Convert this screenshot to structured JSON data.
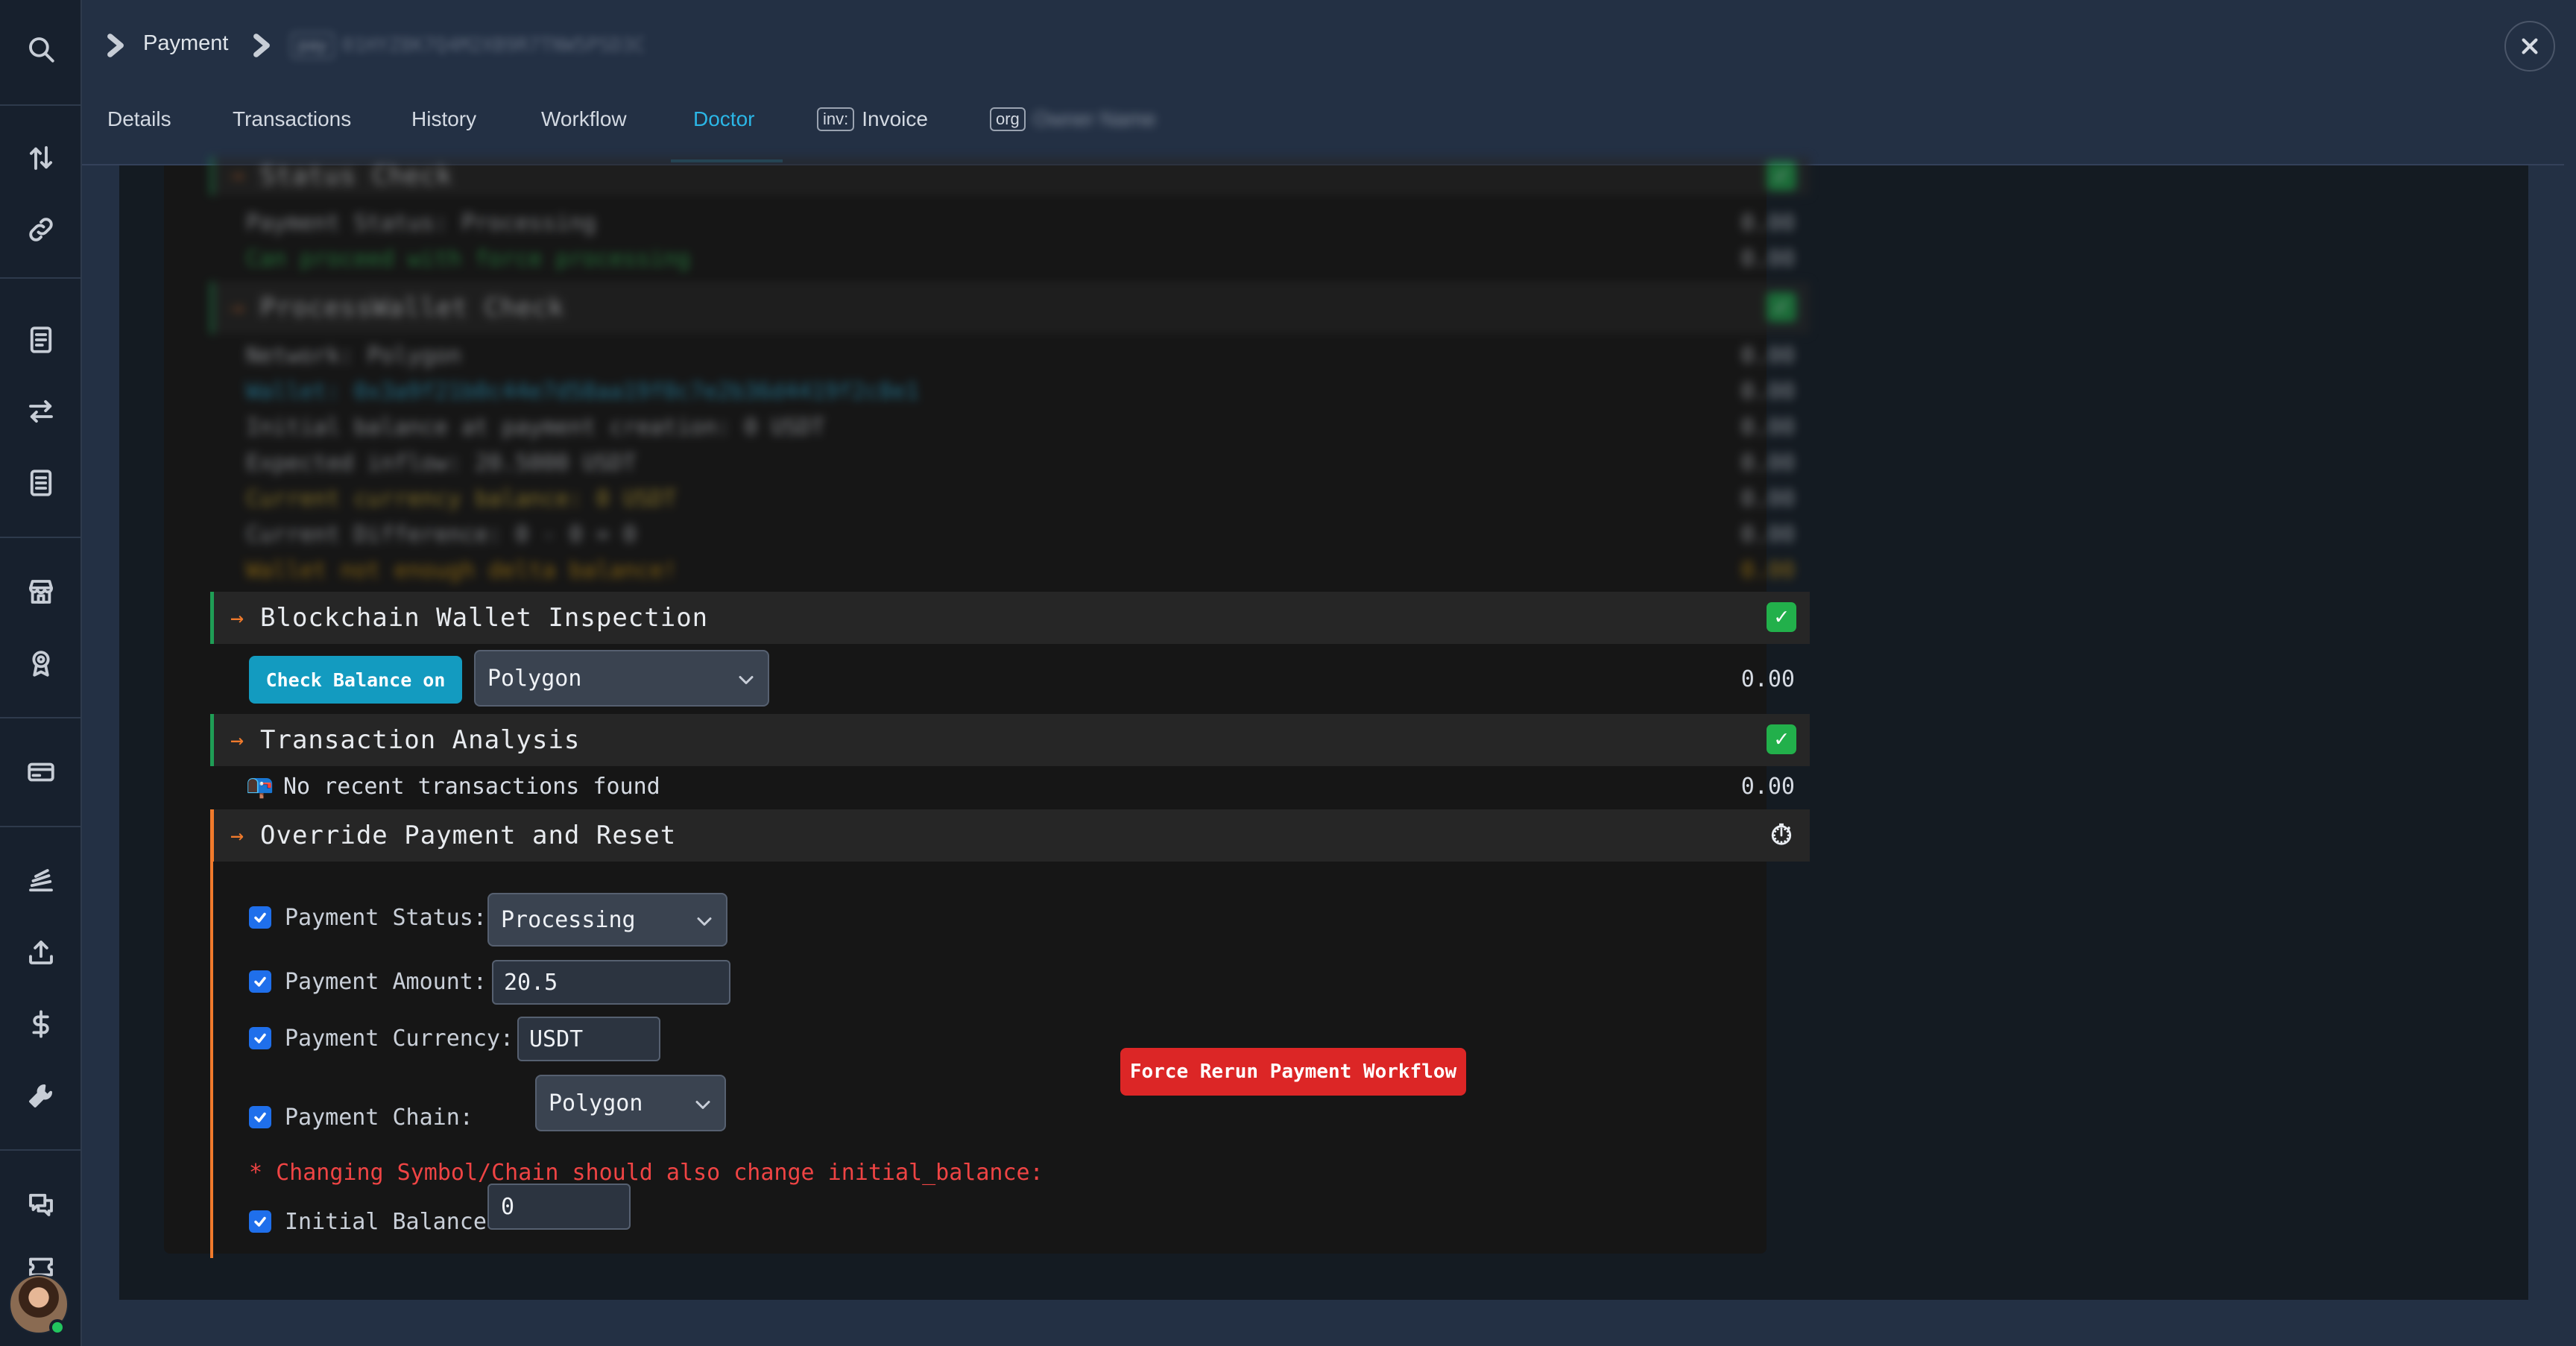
{
  "breadcrumb": {
    "section": "Payment",
    "id_tag": "pay",
    "id_value": "01HYZ8K7Q4M2XB9R7TNW5PSD3C"
  },
  "tabs": [
    {
      "label": "Details"
    },
    {
      "label": "Transactions"
    },
    {
      "label": "History"
    },
    {
      "label": "Workflow"
    },
    {
      "label": "Doctor"
    },
    {
      "chip": "inv:",
      "label": "Invoice"
    },
    {
      "chip": "org",
      "label": "Owner Name"
    }
  ],
  "blurred": {
    "status_check": {
      "title": "Status Check",
      "rows": [
        {
          "text": "Payment Status: Processing",
          "value": "0.00"
        },
        {
          "text": "Can proceed with force processing",
          "value": "0.00"
        }
      ]
    },
    "wallet_check": {
      "title": "ProcessWallet Check",
      "rows": [
        {
          "text": "Network: Polygon",
          "value": "0.00"
        },
        {
          "text": "Wallet: 0x3a9f21b0c44e7d58aa19f0c7e2b36d4419f2c8e1",
          "value": "0.00"
        },
        {
          "text": "Initial balance at payment creation: 0 USDT",
          "value": "0.00"
        },
        {
          "text": "Expected inflow: 20.5000 USDT",
          "value": "0.00"
        },
        {
          "text": "Current currency balance: 0 USDT",
          "value": "0.00"
        },
        {
          "text": "Current Difference: 0 - 0 = 0",
          "value": "0.00"
        },
        {
          "text": "Wallet not enough delta balance!",
          "value": "0.00"
        }
      ]
    }
  },
  "blockchain": {
    "title": "Blockchain Wallet Inspection",
    "check_button": "Check Balance on",
    "network": "Polygon",
    "value": "0.00"
  },
  "transactions": {
    "title": "Transaction Analysis",
    "row_text": "No recent transactions found",
    "value": "0.00"
  },
  "override": {
    "title": "Override Payment and Reset",
    "status_label": "Payment Status:",
    "status_value": "Processing",
    "amount_label": "Payment Amount:",
    "amount_value": "20.5",
    "currency_label": "Payment Currency:",
    "currency_value": "USDT",
    "chain_label": "Payment Chain:",
    "chain_value": "Polygon",
    "note": "* Changing Symbol/Chain should also change initial_balance:",
    "balance_label": "Initial Balance:",
    "balance_value": "0",
    "force_button": "Force Rerun Payment Workflow"
  },
  "colors": {
    "accent": "#2bb6e6",
    "ok": "#22b04b",
    "warn": "#f07a2c",
    "danger": "#dc2626"
  }
}
